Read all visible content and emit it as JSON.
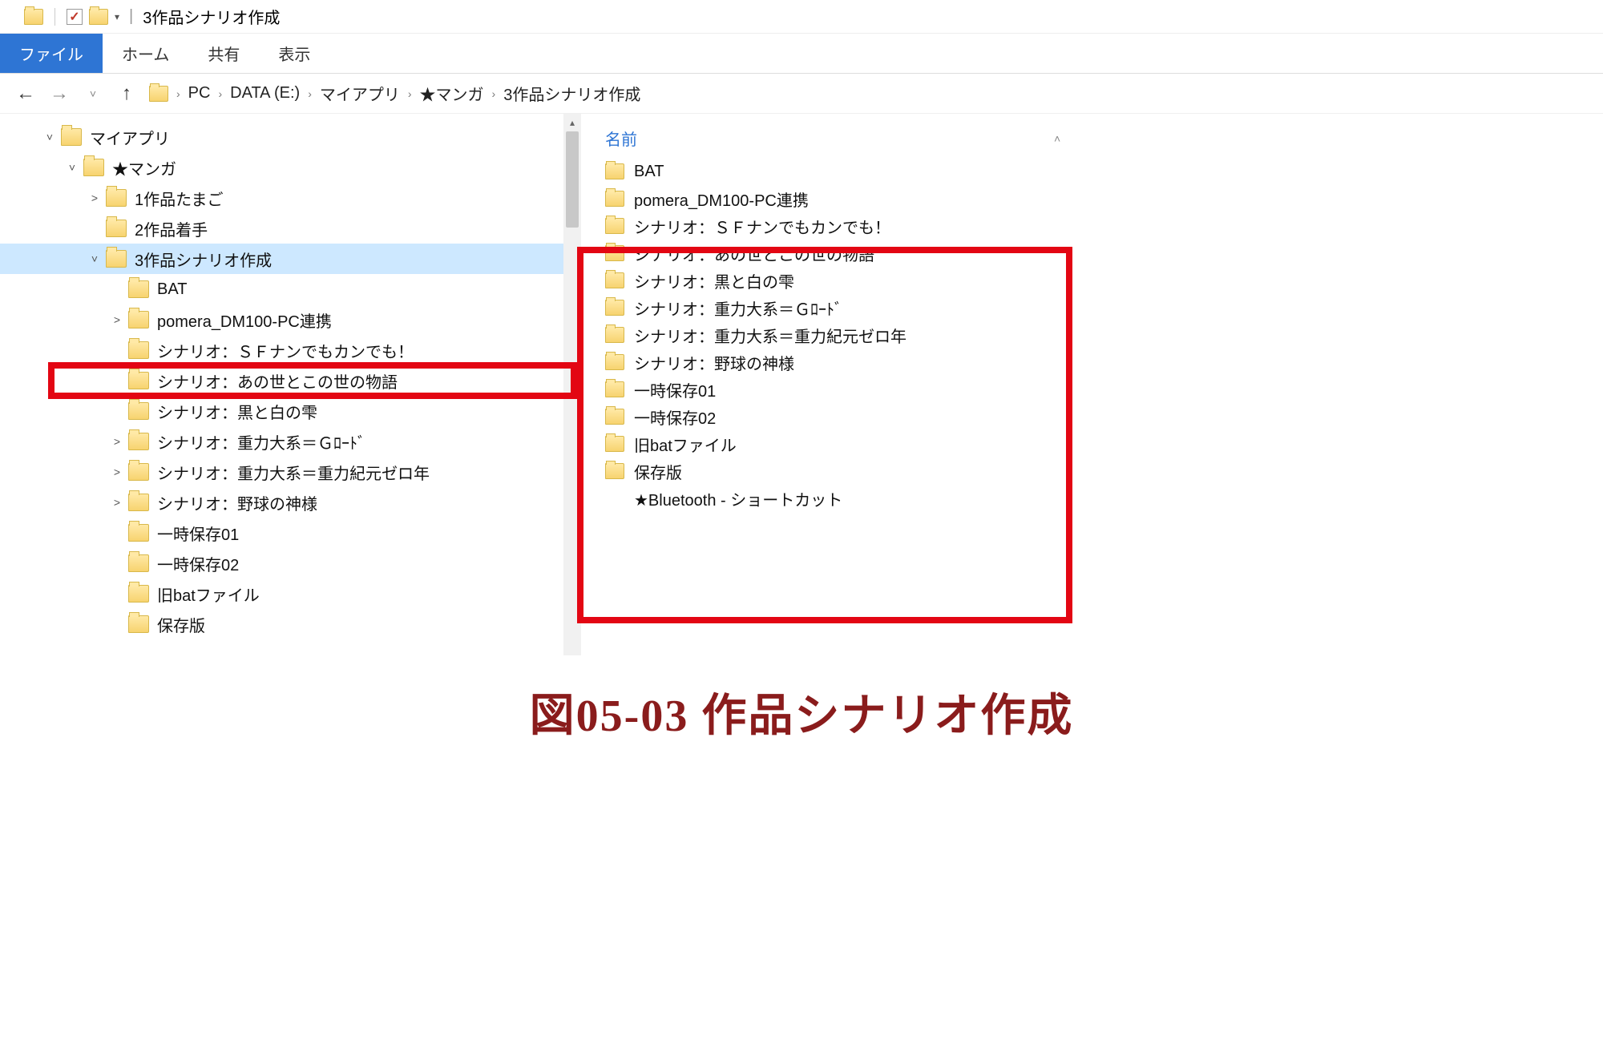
{
  "window": {
    "title": "3作品シナリオ作成"
  },
  "ribbon": {
    "file": "ファイル",
    "home": "ホーム",
    "share": "共有",
    "view": "表示"
  },
  "breadcrumb": [
    "PC",
    "DATA (E:)",
    "マイアプリ",
    "★マンガ",
    "3作品シナリオ作成"
  ],
  "tree": [
    {
      "level": 1,
      "exp": "open",
      "label": "マイアプリ"
    },
    {
      "level": 2,
      "exp": "open",
      "label": "★マンガ"
    },
    {
      "level": 3,
      "exp": "close",
      "label": "1作品たまご"
    },
    {
      "level": 3,
      "exp": "none",
      "label": "2作品着手"
    },
    {
      "level": 3,
      "exp": "open",
      "label": "3作品シナリオ作成",
      "selected": true
    },
    {
      "level": 4,
      "exp": "none",
      "label": "BAT"
    },
    {
      "level": 4,
      "exp": "close",
      "label": "pomera_DM100-PC連携"
    },
    {
      "level": 4,
      "exp": "none",
      "label": "シナリオ：ＳＦナンでもカンでも！"
    },
    {
      "level": 4,
      "exp": "none",
      "label": "シナリオ：あの世とこの世の物語"
    },
    {
      "level": 4,
      "exp": "none",
      "label": "シナリオ：黒と白の雫"
    },
    {
      "level": 4,
      "exp": "close",
      "label": "シナリオ：重力大系＝Ｇﾛｰﾄﾞ"
    },
    {
      "level": 4,
      "exp": "close",
      "label": "シナリオ：重力大系＝重力紀元ゼロ年"
    },
    {
      "level": 4,
      "exp": "close",
      "label": "シナリオ：野球の神様"
    },
    {
      "level": 4,
      "exp": "none",
      "label": "一時保存01"
    },
    {
      "level": 4,
      "exp": "none",
      "label": "一時保存02"
    },
    {
      "level": 4,
      "exp": "none",
      "label": "旧batファイル"
    },
    {
      "level": 4,
      "exp": "none",
      "label": "保存版"
    }
  ],
  "list_header": "名前",
  "list": [
    {
      "type": "folder",
      "label": "BAT"
    },
    {
      "type": "folder",
      "label": "pomera_DM100-PC連携"
    },
    {
      "type": "folder",
      "label": "シナリオ：ＳＦナンでもカンでも！"
    },
    {
      "type": "folder",
      "label": "シナリオ：あの世とこの世の物語"
    },
    {
      "type": "folder",
      "label": "シナリオ：黒と白の雫"
    },
    {
      "type": "folder",
      "label": "シナリオ：重力大系＝Ｇﾛｰﾄﾞ"
    },
    {
      "type": "folder",
      "label": "シナリオ：重力大系＝重力紀元ゼロ年"
    },
    {
      "type": "folder",
      "label": "シナリオ：野球の神様"
    },
    {
      "type": "folder",
      "label": "一時保存01"
    },
    {
      "type": "folder",
      "label": "一時保存02"
    },
    {
      "type": "folder",
      "label": "旧batファイル"
    },
    {
      "type": "folder",
      "label": "保存版"
    },
    {
      "type": "shortcut",
      "label": "★Bluetooth - ショートカット"
    }
  ],
  "caption": "図05-03  作品シナリオ作成"
}
